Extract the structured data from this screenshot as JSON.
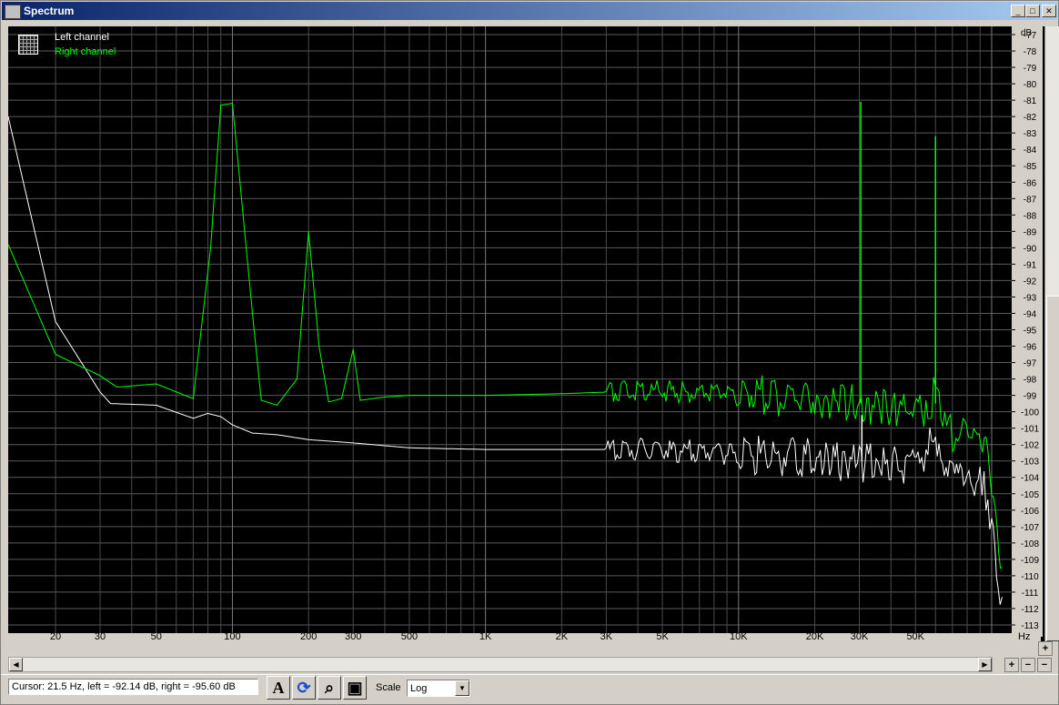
{
  "window": {
    "title": "Spectrum",
    "minimize": "_",
    "maximize": "□",
    "close": "✕"
  },
  "legend": {
    "left": "Left channel",
    "right": "Right channel",
    "left_color": "#ffffff",
    "right_color": "#00ff00"
  },
  "axes": {
    "y_unit": "dB",
    "x_unit": "Hz",
    "y_ticks": [
      "-77",
      "-78",
      "-79",
      "-80",
      "-81",
      "-82",
      "-83",
      "-84",
      "-85",
      "-86",
      "-87",
      "-88",
      "-89",
      "-90",
      "-91",
      "-92",
      "-93",
      "-94",
      "-95",
      "-96",
      "-97",
      "-98",
      "-99",
      "-100",
      "-101",
      "-102",
      "-103",
      "-104",
      "-105",
      "-106",
      "-107",
      "-108",
      "-109",
      "-110",
      "-111",
      "-112",
      "-113"
    ],
    "x_ticks": [
      {
        "label": "20",
        "hz": 20
      },
      {
        "label": "30",
        "hz": 30
      },
      {
        "label": "50",
        "hz": 50
      },
      {
        "label": "100",
        "hz": 100
      },
      {
        "label": "200",
        "hz": 200
      },
      {
        "label": "300",
        "hz": 300
      },
      {
        "label": "500",
        "hz": 500
      },
      {
        "label": "1K",
        "hz": 1000
      },
      {
        "label": "2K",
        "hz": 2000
      },
      {
        "label": "3K",
        "hz": 3000
      },
      {
        "label": "5K",
        "hz": 5000
      },
      {
        "label": "10K",
        "hz": 10000
      },
      {
        "label": "20K",
        "hz": 20000
      },
      {
        "label": "30K",
        "hz": 30000
      },
      {
        "label": "50K",
        "hz": 50000
      }
    ]
  },
  "chart_data": {
    "type": "line",
    "x_scale": "log",
    "xlim": [
      13,
      120000
    ],
    "ylim": [
      -113.5,
      -76.5
    ],
    "grid": true,
    "legend_position": "top-left",
    "series": [
      {
        "name": "Left channel",
        "color": "#ffffff",
        "points": [
          [
            13,
            -82
          ],
          [
            20,
            -94.5
          ],
          [
            30,
            -98.8
          ],
          [
            33,
            -99.5
          ],
          [
            50,
            -99.6
          ],
          [
            70,
            -100.4
          ],
          [
            80,
            -100.1
          ],
          [
            90,
            -100.3
          ],
          [
            100,
            -100.8
          ],
          [
            120,
            -101.3
          ],
          [
            150,
            -101.4
          ],
          [
            200,
            -101.7
          ],
          [
            300,
            -101.9
          ],
          [
            500,
            -102.2
          ],
          [
            1000,
            -102.3
          ],
          [
            2000,
            -102.3
          ],
          [
            3000,
            -102.3
          ],
          [
            5000,
            -102.3
          ],
          [
            10000,
            -102.6
          ],
          [
            20000,
            -102.8
          ],
          [
            30000,
            -103.1
          ],
          [
            40000,
            -103.3
          ],
          [
            48000,
            -103.6
          ],
          [
            52000,
            -103.2
          ],
          [
            55000,
            -102.4
          ],
          [
            58000,
            -101.0
          ],
          [
            60000,
            -102.5
          ],
          [
            65000,
            -104.0
          ],
          [
            80000,
            -104.6
          ],
          [
            90000,
            -104.4
          ],
          [
            95000,
            -104.8
          ],
          [
            100000,
            -106.5
          ],
          [
            103000,
            -108.5
          ],
          [
            106000,
            -110.8
          ],
          [
            110000,
            -111.3
          ]
        ],
        "spikes": [
          [
            30700,
            -100.2
          ]
        ]
      },
      {
        "name": "Right channel",
        "color": "#00ff00",
        "points": [
          [
            13,
            -89.8
          ],
          [
            20,
            -96.5
          ],
          [
            30,
            -97.8
          ],
          [
            35,
            -98.5
          ],
          [
            50,
            -98.3
          ],
          [
            70,
            -99.2
          ],
          [
            82,
            -90
          ],
          [
            90,
            -81.3
          ],
          [
            100,
            -81.2
          ],
          [
            120,
            -94
          ],
          [
            130,
            -99.3
          ],
          [
            150,
            -99.6
          ],
          [
            180,
            -98
          ],
          [
            200,
            -89
          ],
          [
            220,
            -96
          ],
          [
            240,
            -99.4
          ],
          [
            270,
            -99.2
          ],
          [
            300,
            -96.2
          ],
          [
            320,
            -99.3
          ],
          [
            400,
            -99.1
          ],
          [
            500,
            -99.0
          ],
          [
            1000,
            -99.0
          ],
          [
            2000,
            -98.9
          ],
          [
            3000,
            -98.8
          ],
          [
            5000,
            -98.8
          ],
          [
            10000,
            -98.9
          ],
          [
            20000,
            -99.2
          ],
          [
            30000,
            -99.5
          ],
          [
            45000,
            -99.8
          ],
          [
            53000,
            -100.2
          ],
          [
            57000,
            -99.7
          ],
          [
            60000,
            -98.8
          ],
          [
            63000,
            -100.2
          ],
          [
            70000,
            -101.3
          ],
          [
            85000,
            -102.0
          ],
          [
            95000,
            -102.8
          ],
          [
            100000,
            -104.0
          ],
          [
            105000,
            -107.5
          ],
          [
            110000,
            -109.5
          ]
        ],
        "spikes": [
          [
            30400,
            -81.1
          ],
          [
            60000,
            -83.2
          ]
        ]
      }
    ]
  },
  "status": {
    "cursor": "Cursor:  21.5 Hz,  left = -92.14 dB,  right = -95.60 dB",
    "scale_label": "Scale",
    "scale_value": "Log"
  },
  "icons": {
    "text_tool": "A",
    "refresh": "⟳",
    "zoom_tool": "⌕",
    "save": "▣"
  }
}
